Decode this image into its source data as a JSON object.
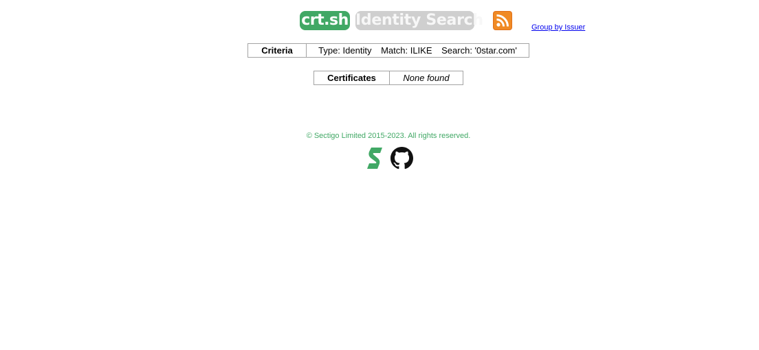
{
  "header": {
    "logo_text": "crt.sh",
    "page_title": "Identity Search",
    "rss_icon": "rss-feed-icon",
    "group_by_link": "Group by Issuer"
  },
  "criteria": {
    "header": "Criteria",
    "type": "Type: Identity",
    "match": "Match: ILIKE",
    "search": "Search: '0star.com'"
  },
  "certificates": {
    "header": "Certificates",
    "value": "None found"
  },
  "footer": {
    "copyright": "© Sectigo Limited 2015-2023. All rights reserved.",
    "sectigo_icon": "sectigo-logo-icon",
    "github_icon": "github-icon"
  },
  "colors": {
    "brand_green": "#41a865",
    "title_gray": "#cfcfcf",
    "rss_orange": "#f08a24",
    "link_blue": "#0000ee"
  }
}
